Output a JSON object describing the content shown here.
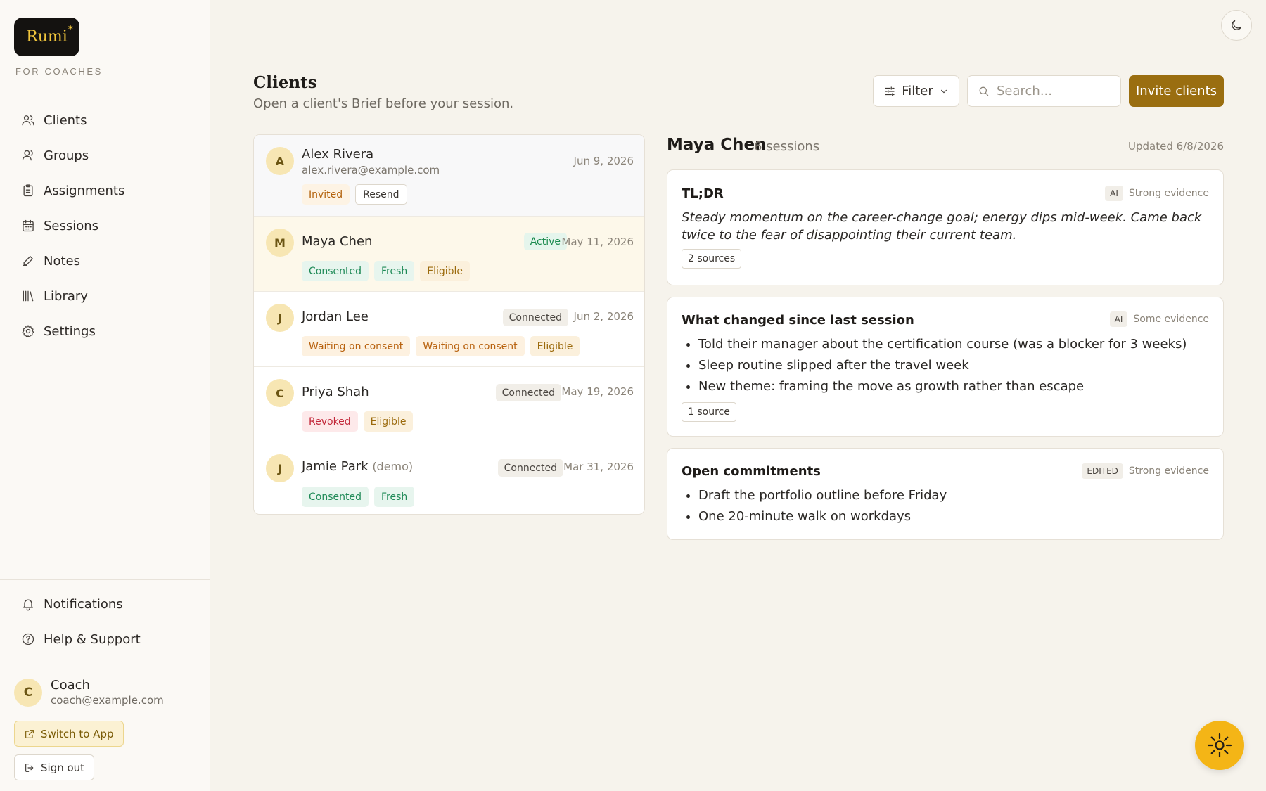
{
  "brand": {
    "logo_text": "Rumi",
    "logo_sun": "✶",
    "tagline": "FOR COACHES"
  },
  "sidebar": {
    "items": [
      {
        "label": "Clients",
        "icon": "users-icon"
      },
      {
        "label": "Groups",
        "icon": "group-icon"
      },
      {
        "label": "Assignments",
        "icon": "clipboard-icon"
      },
      {
        "label": "Sessions",
        "icon": "calendar-icon"
      },
      {
        "label": "Notes",
        "icon": "pen-icon"
      },
      {
        "label": "Library",
        "icon": "library-icon"
      },
      {
        "label": "Settings",
        "icon": "gear-icon"
      }
    ],
    "bottom_items": [
      {
        "label": "Notifications",
        "icon": "bell-icon"
      },
      {
        "label": "Help & Support",
        "icon": "help-icon"
      }
    ],
    "user": {
      "initial": "C",
      "name": "Coach",
      "email": "coach@example.com"
    },
    "switch_label": "Switch to App",
    "signout_label": "Sign out"
  },
  "header": {
    "title": "Clients",
    "subtitle": "Open a client's Brief before your session.",
    "filter_label": "Filter",
    "search_placeholder": "Search...",
    "invite_label": "Invite clients"
  },
  "clients": [
    {
      "initial": "A",
      "name": "Alex Rivera",
      "email": "alex.rivera@example.com",
      "date": "Jun 9, 2026",
      "status": "",
      "tags": [
        "Invited",
        "Resend"
      ]
    },
    {
      "initial": "M",
      "name": "Maya Chen",
      "date": "May 11, 2026",
      "status": "Active",
      "tags": [
        "Consented",
        "Fresh",
        "Eligible"
      ]
    },
    {
      "initial": "J",
      "name": "Jordan Lee",
      "date": "Jun 2, 2026",
      "status": "Connected",
      "tags": [
        "Waiting on consent",
        "Waiting on consent",
        "Eligible"
      ]
    },
    {
      "initial": "C",
      "name": "Priya Shah",
      "date": "May 19, 2026",
      "status": "Connected",
      "tags": [
        "Revoked",
        "Eligible"
      ]
    },
    {
      "initial": "J",
      "name": "Jamie Park",
      "name_suffix": "(demo)",
      "date": "Mar 31, 2026",
      "status": "Connected",
      "tags": [
        "Consented",
        "Fresh"
      ]
    }
  ],
  "detail": {
    "name": "Maya Chen",
    "sessions": "6 sessions",
    "updated": "Updated 6/8/2026",
    "cards": [
      {
        "title": "TL;DR",
        "badge": "AI",
        "evidence": "Strong evidence",
        "text": "Steady momentum on the career-change goal; energy dips mid-week. Came back twice to the fear of disappointing their current team.",
        "sources": "2 sources"
      },
      {
        "title": "What changed since last session",
        "badge": "AI",
        "evidence": "Some evidence",
        "items": [
          "Told their manager about the certification course (was a blocker for 3 weeks)",
          "Sleep routine slipped after the travel week",
          "New theme: framing the move as growth rather than escape"
        ],
        "sources": "1 source"
      },
      {
        "title": "Open commitments",
        "badge": "EDITED",
        "evidence": "Strong evidence",
        "items": [
          "Draft the portfolio outline before Friday",
          "One 20-minute walk on workdays"
        ]
      }
    ]
  },
  "colors": {
    "accent": "#9a6e10",
    "fab": "#f4b516",
    "selected_row": "#fdf8ea"
  }
}
